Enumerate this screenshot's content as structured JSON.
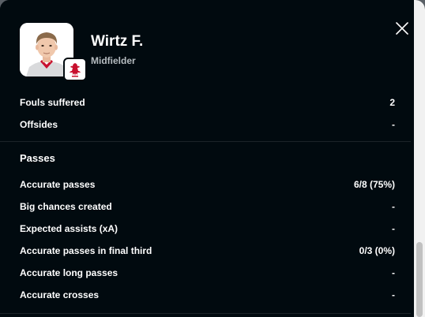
{
  "player": {
    "name": "Wirtz F.",
    "position": "Midfielder",
    "photo_icon": "player-photo",
    "club_icon": "liverpool-crest-icon"
  },
  "stats_top": [
    {
      "label": "Fouls suffered",
      "value": "2"
    },
    {
      "label": "Offsides",
      "value": "-"
    }
  ],
  "passes": {
    "title": "Passes",
    "rows": [
      {
        "label": "Accurate passes",
        "value": "6/8 (75%)"
      },
      {
        "label": "Big chances created",
        "value": "-"
      },
      {
        "label": "Expected assists (xA)",
        "value": "-"
      },
      {
        "label": "Accurate passes in final third",
        "value": "0/3 (0%)"
      },
      {
        "label": "Accurate long passes",
        "value": "-"
      },
      {
        "label": "Accurate crosses",
        "value": "-"
      }
    ]
  },
  "colors": {
    "background": "#010a0f",
    "text": "#ffffff",
    "subtext": "#b6bcc0",
    "divider": "#1b2328",
    "club": "#c8102e"
  }
}
